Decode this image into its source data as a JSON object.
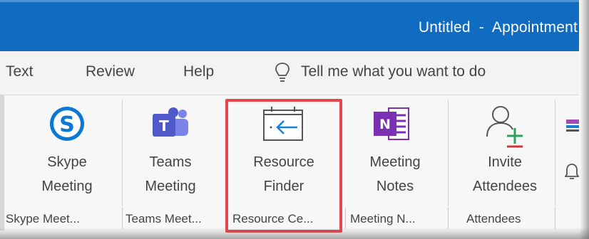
{
  "window": {
    "title": "Untitled  -  Appointment"
  },
  "menu": {
    "items": [
      "Text",
      "Review",
      "Help"
    ],
    "tell_me": "Tell me what you want to do"
  },
  "groups": [
    {
      "button_line1": "Skype",
      "button_line2": "Meeting",
      "group_label": "Skype Meet...",
      "icon": "skype-icon"
    },
    {
      "button_line1": "Teams",
      "button_line2": "Meeting",
      "group_label": "Teams Meet...",
      "icon": "teams-icon"
    },
    {
      "button_line1": "Resource",
      "button_line2": "Finder",
      "group_label": "Resource Ce...",
      "icon": "calendar-arrow-icon"
    },
    {
      "button_line1": "Meeting",
      "button_line2": "Notes",
      "group_label": "Meeting N...",
      "icon": "onenote-icon"
    },
    {
      "button_line1": "Invite",
      "button_line2": "Attendees",
      "group_label": "Attendees",
      "icon": "add-person-icon"
    }
  ],
  "colors": {
    "titlebar": "#0f6cc1",
    "highlight": "#e8454a",
    "skype": "#0a78d4",
    "teams": "#5059c9",
    "onenote": "#7b2fb2"
  }
}
